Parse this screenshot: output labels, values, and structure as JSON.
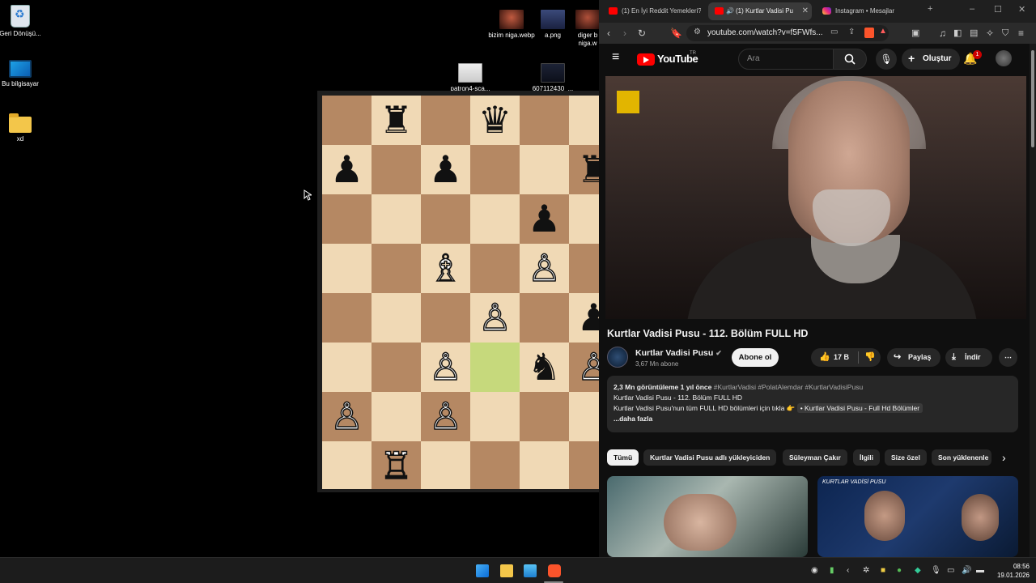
{
  "desktop": {
    "icons": [
      {
        "label": "Geri Dönüşü...",
        "icon": "recycle-bin-icon"
      },
      {
        "label": "Bu bilgisayar",
        "icon": "computer-icon"
      },
      {
        "label": "xd",
        "icon": "folder-icon"
      },
      {
        "label": "bizim niga.webp",
        "icon": "image-file-icon"
      },
      {
        "label": "a.png",
        "icon": "image-file-icon"
      },
      {
        "label": "diger b niga.w",
        "icon": "image-file-icon"
      },
      {
        "label": "patron4-sca...",
        "icon": "image-file-icon"
      },
      {
        "label": "607112430_...",
        "icon": "image-file-icon"
      }
    ]
  },
  "chess": {
    "files": [
      "a",
      "b",
      "c",
      "d",
      "e",
      "f"
    ],
    "highlight_square": "d3",
    "pieces": [
      {
        "square": "b8",
        "glyph": "♜",
        "color": "black"
      },
      {
        "square": "d8",
        "glyph": "♛",
        "color": "black"
      },
      {
        "square": "a7",
        "glyph": "♟",
        "color": "black"
      },
      {
        "square": "c7",
        "glyph": "♟",
        "color": "black"
      },
      {
        "square": "f7",
        "glyph": "♜",
        "color": "black"
      },
      {
        "square": "e6",
        "glyph": "♟",
        "color": "black"
      },
      {
        "square": "c5",
        "glyph": "♗",
        "color": "white"
      },
      {
        "square": "e5",
        "glyph": "♙",
        "color": "white"
      },
      {
        "square": "d4",
        "glyph": "♙",
        "color": "white"
      },
      {
        "square": "f4",
        "glyph": "♟",
        "color": "black"
      },
      {
        "square": "c3",
        "glyph": "♙",
        "color": "white"
      },
      {
        "square": "e3",
        "glyph": "♞",
        "color": "black"
      },
      {
        "square": "f3",
        "glyph": "♙",
        "color": "white"
      },
      {
        "square": "a2",
        "glyph": "♙",
        "color": "white"
      },
      {
        "square": "c2",
        "glyph": "♙",
        "color": "white"
      },
      {
        "square": "b1",
        "glyph": "♖",
        "color": "white"
      }
    ]
  },
  "browser": {
    "tabs": [
      {
        "label": "(1) En İyi Reddit Yemekleri?",
        "active": false,
        "favicon": "youtube"
      },
      {
        "label": "(1) Kurtlar Vadisi Pu",
        "active": true,
        "favicon": "youtube"
      },
      {
        "label": "Instagram • Mesajlar",
        "active": false,
        "favicon": "instagram"
      }
    ],
    "url": "youtube.com/watch?v=f5FWfs..."
  },
  "youtube": {
    "logo_text": "YouTube",
    "region": "TR",
    "search_placeholder": "Ara",
    "create_label": "Oluştur",
    "notification_count": "1",
    "video_title": "Kurtlar Vadisi Pusu - 112. Bölüm FULL HD",
    "channel_name": "Kurtlar Vadisi Pusu",
    "subscribers": "3,67 Mn abone",
    "subscribe_label": "Abone ol",
    "likes": "17 B",
    "share_label": "Paylaş",
    "download_label": "İndir",
    "description": {
      "stats": "2,3 Mn görüntüleme  1 yıl önce",
      "tags": "#KurtlarVadisi #PolatAlemdar #KurtlarVadisiPusu",
      "line2": "Kurtlar Vadisi Pusu - 112. Bölüm FULL HD",
      "line3": "Kurtlar Vadisi Pusu'nun tüm FULL HD bölümleri için tıkla 👉",
      "link": "• Kurtlar Vadisi Pusu - Full Hd Bölümler",
      "more": "...daha fazla"
    },
    "chips": [
      "Tümü",
      "Kurtlar Vadisi Pusu adlı yükleyiciden",
      "Süleyman Çakır",
      "İlgili",
      "Size özel",
      "Son yüklenenle"
    ],
    "related_thumb_text": "KURTLAR VADİSİ PUSU"
  },
  "taskbar": {
    "time": "08:56",
    "date": "19.01.2026"
  }
}
